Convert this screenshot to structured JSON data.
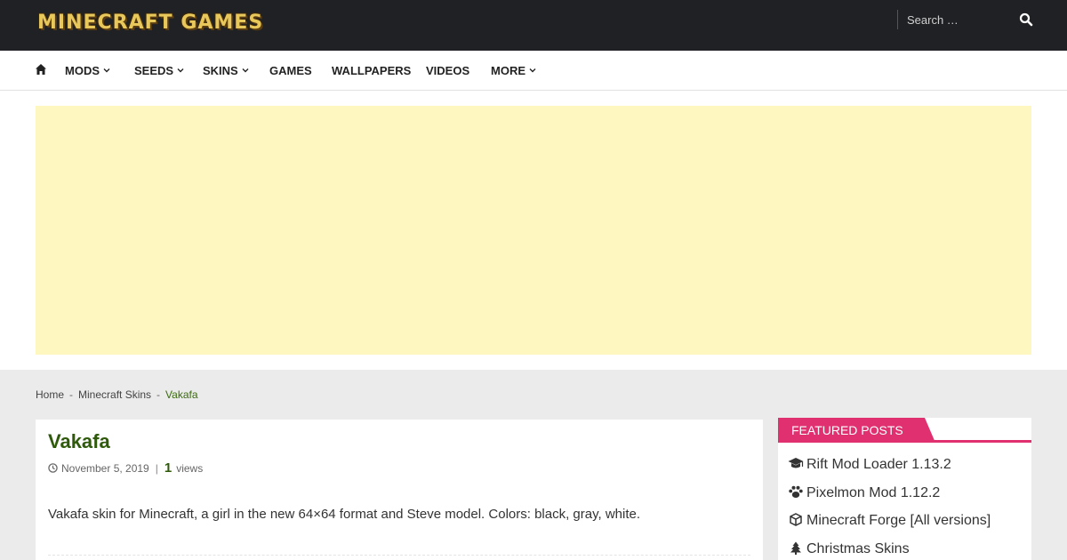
{
  "header": {
    "logo_text": "MINECRAFT GAMES",
    "search": {
      "placeholder": "Search …"
    }
  },
  "nav": {
    "items": [
      {
        "label": "MODS",
        "has_dropdown": true
      },
      {
        "label": "SEEDS",
        "has_dropdown": true
      },
      {
        "label": "SKINS",
        "has_dropdown": true
      },
      {
        "label": "GAMES",
        "has_dropdown": false
      },
      {
        "label": "WALLPAPERS",
        "has_dropdown": false
      },
      {
        "label": "VIDEOS",
        "has_dropdown": false
      },
      {
        "label": "MORE",
        "has_dropdown": true
      }
    ]
  },
  "breadcrumb": {
    "home": "Home",
    "separator": "-",
    "category": "Minecraft Skins",
    "current": "Vakafa"
  },
  "article": {
    "title": "Vakafa",
    "date": "November 5, 2019",
    "meta_separator": "|",
    "views_count": "1",
    "views_label": "views",
    "excerpt": "Vakafa skin for Minecraft, a girl in the new 64×64 format and Steve model. Colors: black, gray, white."
  },
  "sidebar": {
    "featured_title": "FEATURED POSTS",
    "featured_posts": [
      {
        "icon": "graduation-cap-icon",
        "label": "Rift Mod Loader 1.13.2"
      },
      {
        "icon": "paw-icon",
        "label": "Pixelmon Mod 1.12.2"
      },
      {
        "icon": "cube-icon",
        "label": "Minecraft Forge [All versions]"
      },
      {
        "icon": "tree-icon",
        "label": "Christmas Skins"
      }
    ]
  },
  "colors": {
    "topbar": "#202124",
    "accent_pink": "#e0306f",
    "title_green": "#2f5a0c",
    "ad_yellow": "#fef8c0"
  }
}
